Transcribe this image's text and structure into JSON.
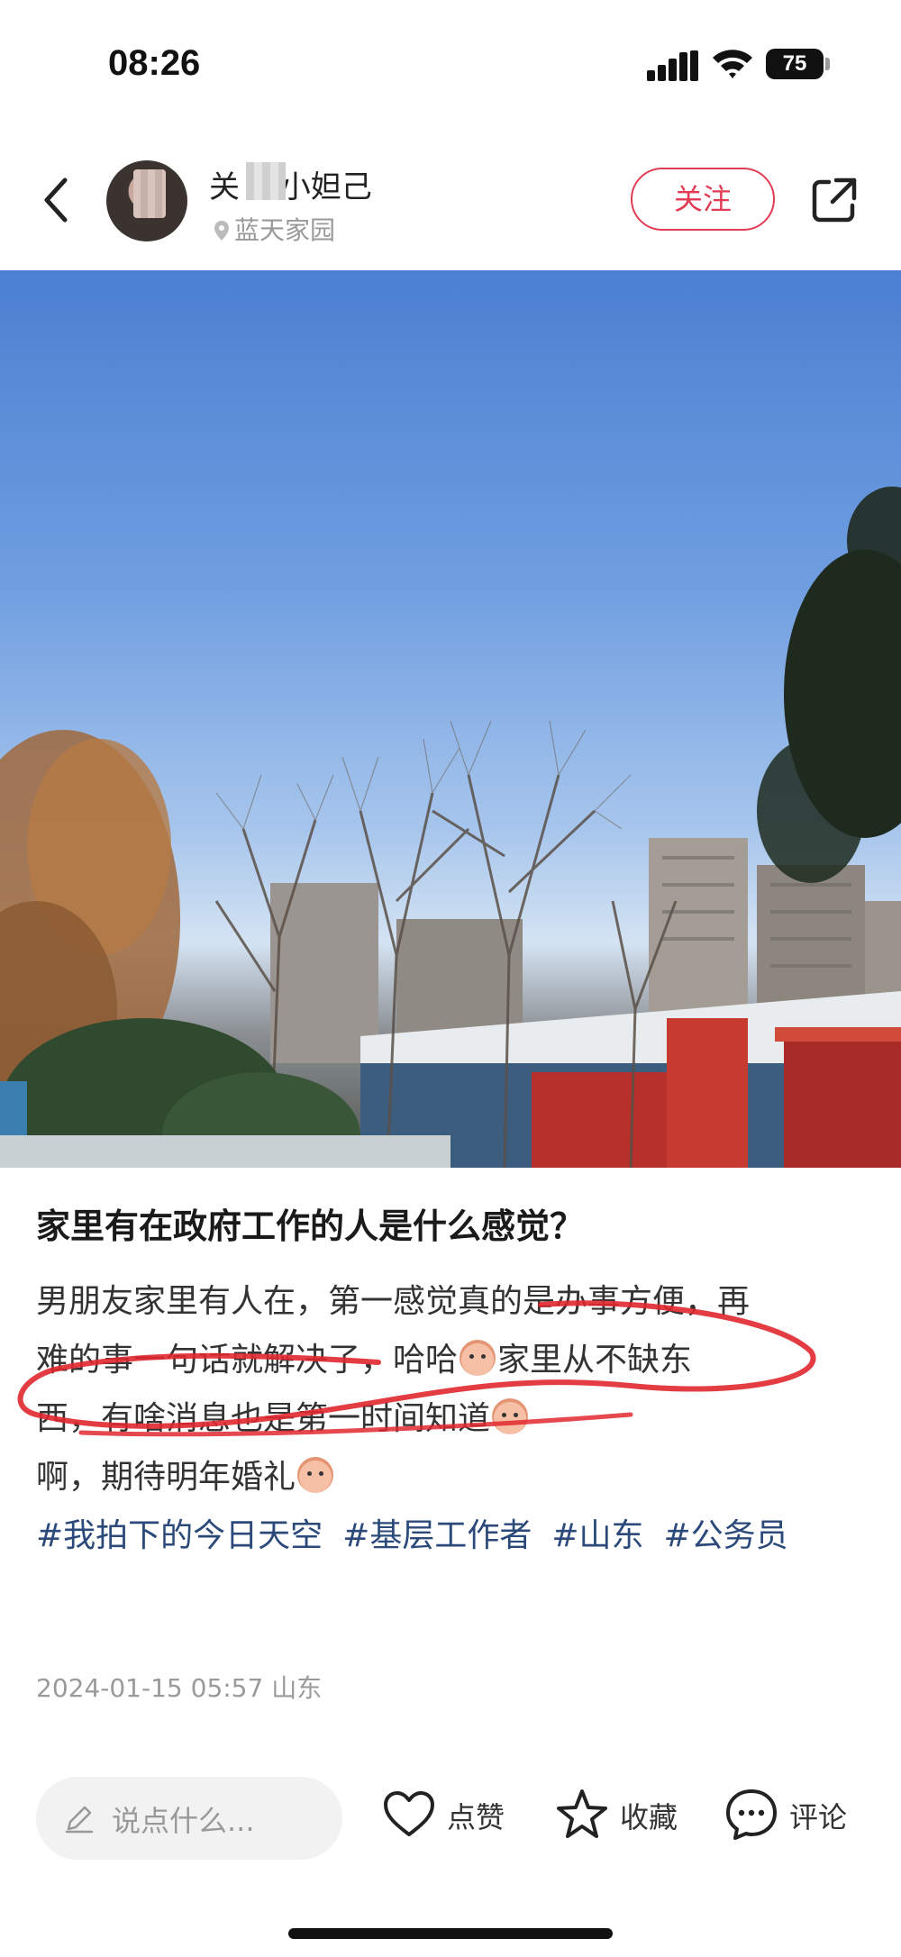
{
  "status_bar": {
    "time": "08:26",
    "battery": "75",
    "icons": [
      "signal-icon",
      "wifi-icon",
      "battery-icon"
    ]
  },
  "header": {
    "author_name": "关 的小妲己",
    "location": "蓝天家园",
    "follow_label": "关注",
    "icons": [
      "back-icon",
      "avatar",
      "location-pin-icon",
      "share-icon"
    ]
  },
  "post": {
    "title": "家里有在政府工作的人是什么感觉？",
    "body_lines": [
      "男朋友家里有人在，第一感觉真的是办事方便，再",
      "难的事一句话就解决了，哈哈",
      "家里从不缺东",
      "西，有啥消息也是第一时间知道",
      "啊，期待明年婚礼"
    ],
    "tags": [
      "#我拍下的今日天空",
      "#基层工作者",
      "#山东",
      "#公务员"
    ],
    "date_location": "2024-01-15 05:57 山东"
  },
  "bottom_bar": {
    "comment_placeholder": "说点什么...",
    "like_label": "点赞",
    "collect_label": "收藏",
    "comment_label": "评论"
  },
  "colors": {
    "accent": "#e23c54",
    "tag": "#2b4a7a",
    "scribble": "#e0282f"
  }
}
